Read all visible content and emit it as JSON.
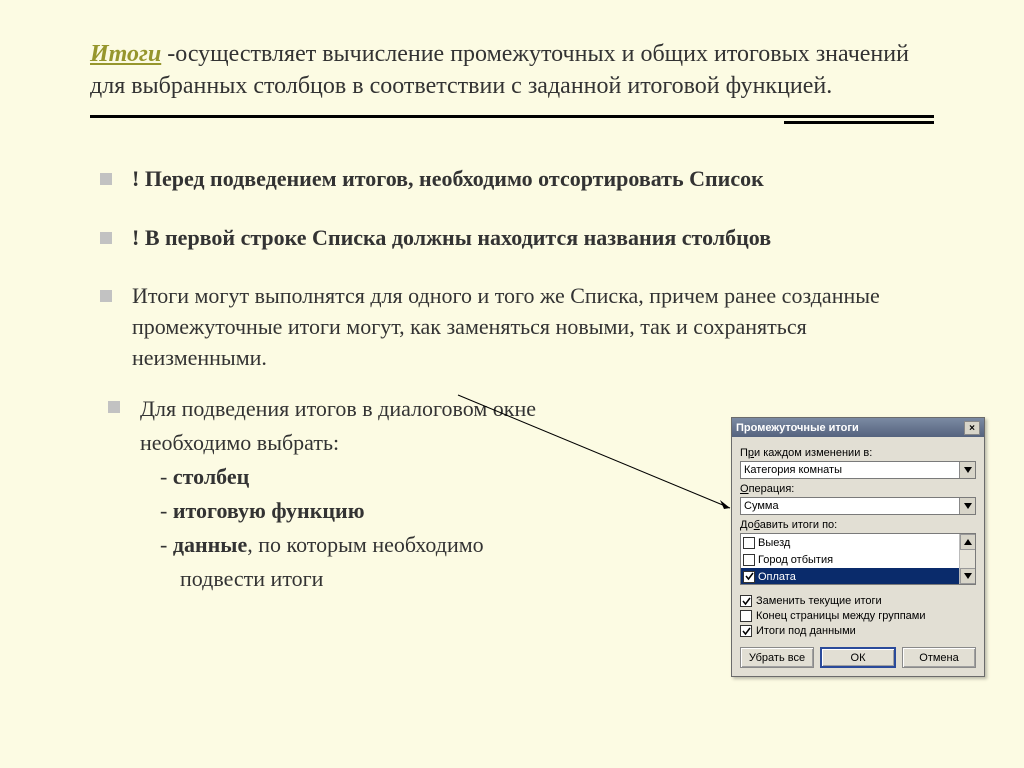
{
  "header": {
    "title_word": "Итоги",
    "title_rest": "  -осуществляет вычисление промежуточных и общих итоговых значений для выбранных столбцов   в соответствии с заданной итоговой функцией."
  },
  "bullets": [
    "! Перед подведением итогов, необходимо отсортировать Список",
    "! В первой строке Списка должны находится названия столбцов",
    "Итоги могут выполнятся для одного и того же Списка, причем ранее созданные промежуточные итоги могут, как заменяться новыми, так и сохраняться неизменными."
  ],
  "lower": {
    "intro_line1": "Для подведения итогов в диалоговом окне",
    "intro_line2": " необходимо выбрать:",
    "items": [
      {
        "prefix": "- ",
        "bold": "столбец",
        "rest": ""
      },
      {
        "prefix": "-  ",
        "bold": "итоговую функцию",
        "rest": ""
      },
      {
        "prefix": "- ",
        "bold": "данные",
        "rest": ", по которым необходимо"
      }
    ],
    "tail": "подвести итоги"
  },
  "dialog": {
    "title": "Промежуточные итоги",
    "label_change_pre": "П",
    "label_change_ul": "р",
    "label_change_post": "и каждом изменении в:",
    "combo_change": "Категория комнаты",
    "label_op_ul": "О",
    "label_op_post": "перация:",
    "combo_op": "Сумма",
    "label_add_pre": "До",
    "label_add_ul": "б",
    "label_add_post": "авить итоги по:",
    "list_items": [
      {
        "checked": false,
        "label": "Выезд",
        "selected": false
      },
      {
        "checked": false,
        "label": "Город отбытия",
        "selected": false
      },
      {
        "checked": true,
        "label": "Оплата",
        "selected": true
      }
    ],
    "checkbox_replace_ul": "З",
    "checkbox_replace_rest": "аменить текущие итоги",
    "checkbox_pagebreak_ul": "К",
    "checkbox_pagebreak_rest": "онец страницы между группами",
    "checkbox_below_pre": "Итоги ",
    "checkbox_below_ul": "п",
    "checkbox_below_post": "од данными",
    "btn_remove": "Убрать все",
    "btn_ok": "ОК",
    "btn_cancel": "Отмена"
  }
}
